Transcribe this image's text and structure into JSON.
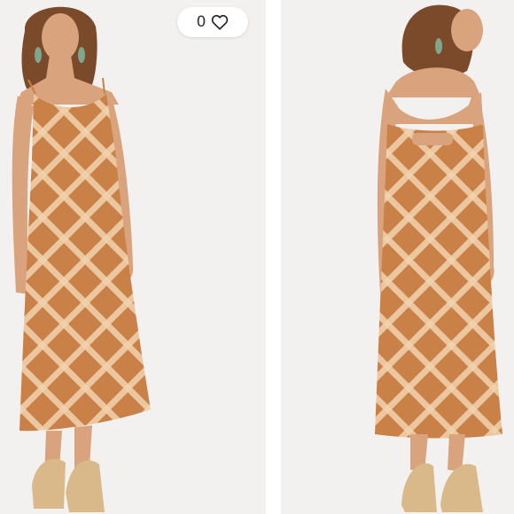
{
  "listing": {
    "like_count": "0"
  },
  "icons": {
    "like": "heart-outline-icon"
  },
  "colors": {
    "dress": "#c98148",
    "dress_pattern": "#f1d2ae",
    "skin": "#d9a37d",
    "hair": "#7a4a2a",
    "sandal": "#d9b98a",
    "photo_background": "#f2f1ef"
  }
}
